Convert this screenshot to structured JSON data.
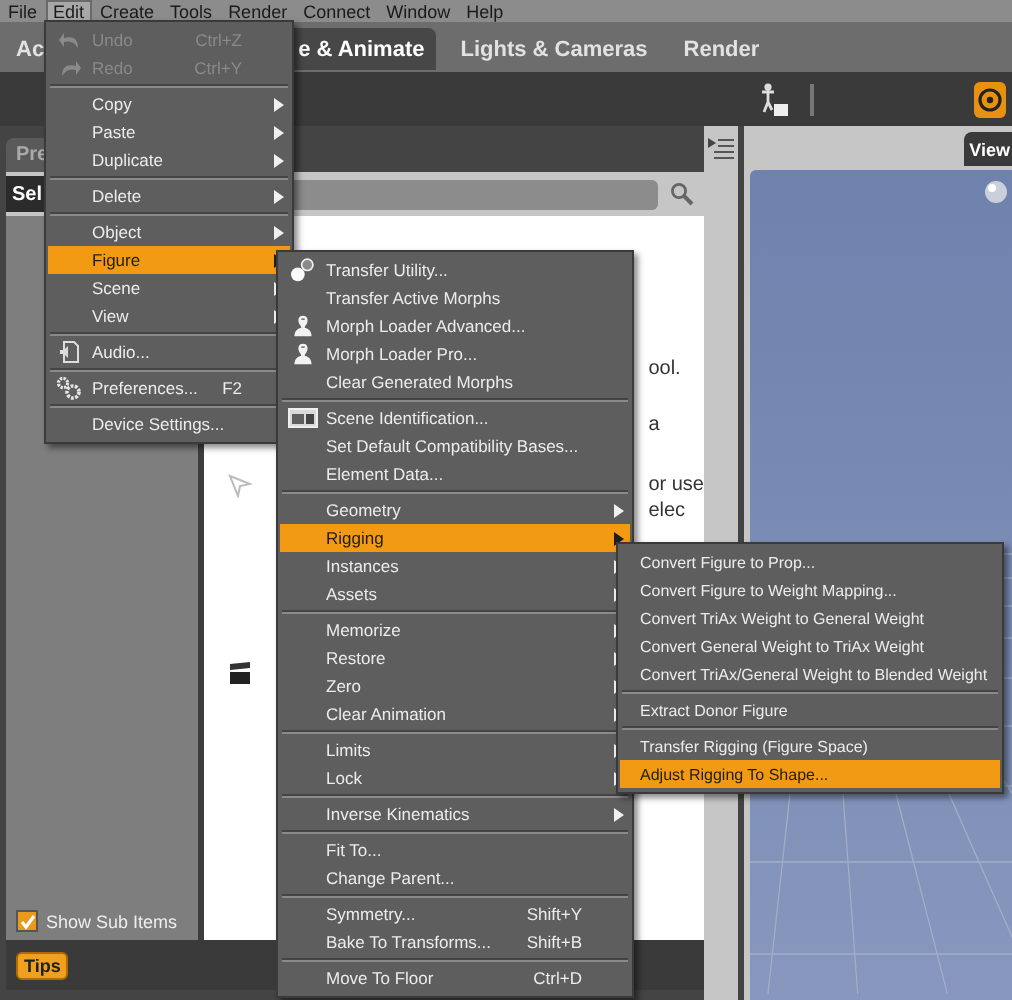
{
  "menu_bar": [
    {
      "label": "File",
      "selected": false
    },
    {
      "label": "Edit",
      "selected": true
    },
    {
      "label": "Create",
      "selected": false
    },
    {
      "label": "Tools",
      "selected": false
    },
    {
      "label": "Render",
      "selected": false
    },
    {
      "label": "Connect",
      "selected": false
    },
    {
      "label": "Window",
      "selected": false
    },
    {
      "label": "Help",
      "selected": false
    }
  ],
  "tabs": [
    {
      "label": "Ac",
      "selected": false
    },
    {
      "label": "e & Animate",
      "selected": true
    },
    {
      "label": "Lights & Cameras",
      "selected": false
    },
    {
      "label": "Render",
      "selected": false
    }
  ],
  "left_panel": {
    "tab": "Pre",
    "row_label": "Sel",
    "content_fragments": [
      "ool.",
      "a",
      "or use",
      "elec"
    ],
    "show_sub_items": {
      "label": "Show Sub Items",
      "checked": true
    },
    "tips_button": "Tips"
  },
  "viewport": {
    "tab": "View"
  },
  "menus": [
    {
      "items": [
        {
          "kind": "item",
          "label": "Undo",
          "shortcut": "Ctrl+Z",
          "submenu": false,
          "selected": false,
          "disabled": true
        },
        {
          "kind": "item",
          "label": "Redo",
          "shortcut": "Ctrl+Y",
          "submenu": false,
          "selected": false,
          "disabled": true
        },
        {
          "kind": "separator"
        },
        {
          "kind": "item",
          "label": "Copy",
          "submenu": true,
          "selected": false,
          "disabled": false
        },
        {
          "kind": "item",
          "label": "Paste",
          "submenu": true,
          "selected": false,
          "disabled": false
        },
        {
          "kind": "item",
          "label": "Duplicate",
          "submenu": true,
          "selected": false,
          "disabled": false
        },
        {
          "kind": "separator"
        },
        {
          "kind": "item",
          "label": "Delete",
          "submenu": true,
          "selected": false,
          "disabled": false
        },
        {
          "kind": "separator"
        },
        {
          "kind": "item",
          "label": "Object",
          "submenu": true,
          "selected": false,
          "disabled": false
        },
        {
          "kind": "item",
          "label": "Figure",
          "submenu": true,
          "selected": true,
          "disabled": false
        },
        {
          "kind": "item",
          "label": "Scene",
          "submenu": true,
          "selected": false,
          "disabled": false
        },
        {
          "kind": "item",
          "label": "View",
          "submenu": true,
          "selected": false,
          "disabled": false
        },
        {
          "kind": "separator"
        },
        {
          "kind": "item",
          "label": "Audio...",
          "submenu": false,
          "selected": false,
          "disabled": false
        },
        {
          "kind": "separator"
        },
        {
          "kind": "item",
          "label": "Preferences...",
          "shortcut": "F2",
          "submenu": false,
          "selected": false,
          "disabled": false
        },
        {
          "kind": "separator"
        },
        {
          "kind": "item",
          "label": "Device Settings...",
          "submenu": false,
          "selected": false,
          "disabled": false
        }
      ]
    },
    {
      "items": [
        {
          "kind": "item",
          "label": "Transfer Utility...",
          "submenu": false,
          "selected": false
        },
        {
          "kind": "item",
          "label": "Transfer Active Morphs",
          "submenu": false,
          "selected": false
        },
        {
          "kind": "item",
          "label": "Morph Loader Advanced...",
          "submenu": false,
          "selected": false
        },
        {
          "kind": "item",
          "label": "Morph Loader Pro...",
          "submenu": false,
          "selected": false
        },
        {
          "kind": "item",
          "label": "Clear Generated Morphs",
          "submenu": false,
          "selected": false
        },
        {
          "kind": "separator"
        },
        {
          "kind": "item",
          "label": "Scene Identification...",
          "submenu": false,
          "selected": false
        },
        {
          "kind": "item",
          "label": "Set Default Compatibility Bases...",
          "submenu": false,
          "selected": false
        },
        {
          "kind": "item",
          "label": "Element Data...",
          "submenu": false,
          "selected": false
        },
        {
          "kind": "separator"
        },
        {
          "kind": "item",
          "label": "Geometry",
          "submenu": true,
          "selected": false
        },
        {
          "kind": "item",
          "label": "Rigging",
          "submenu": true,
          "selected": true
        },
        {
          "kind": "item",
          "label": "Instances",
          "submenu": true,
          "selected": false
        },
        {
          "kind": "item",
          "label": "Assets",
          "submenu": true,
          "selected": false
        },
        {
          "kind": "separator"
        },
        {
          "kind": "item",
          "label": "Memorize",
          "submenu": true,
          "selected": false
        },
        {
          "kind": "item",
          "label": "Restore",
          "submenu": true,
          "selected": false
        },
        {
          "kind": "item",
          "label": "Zero",
          "submenu": true,
          "selected": false
        },
        {
          "kind": "item",
          "label": "Clear Animation",
          "submenu": true,
          "selected": false
        },
        {
          "kind": "separator"
        },
        {
          "kind": "item",
          "label": "Limits",
          "submenu": true,
          "selected": false
        },
        {
          "kind": "item",
          "label": "Lock",
          "submenu": true,
          "selected": false
        },
        {
          "kind": "separator"
        },
        {
          "kind": "item",
          "label": "Inverse Kinematics",
          "submenu": true,
          "selected": false
        },
        {
          "kind": "separator"
        },
        {
          "kind": "item",
          "label": "Fit To...",
          "submenu": false,
          "selected": false
        },
        {
          "kind": "item",
          "label": "Change Parent...",
          "submenu": false,
          "selected": false
        },
        {
          "kind": "separator"
        },
        {
          "kind": "item",
          "label": "Symmetry...",
          "shortcut": "Shift+Y",
          "submenu": false,
          "selected": false
        },
        {
          "kind": "item",
          "label": "Bake To Transforms...",
          "shortcut": "Shift+B",
          "submenu": false,
          "selected": false
        },
        {
          "kind": "separator"
        },
        {
          "kind": "item",
          "label": "Move To Floor",
          "shortcut": "Ctrl+D",
          "submenu": false,
          "selected": false
        }
      ]
    },
    {
      "items": [
        {
          "kind": "item",
          "label": "Convert Figure to Prop...",
          "submenu": false,
          "selected": false
        },
        {
          "kind": "item",
          "label": "Convert Figure to Weight Mapping...",
          "submenu": false,
          "selected": false
        },
        {
          "kind": "item",
          "label": "Convert TriAx Weight to General Weight",
          "submenu": false,
          "selected": false
        },
        {
          "kind": "item",
          "label": "Convert General Weight to TriAx Weight",
          "submenu": false,
          "selected": false
        },
        {
          "kind": "item",
          "label": "Convert TriAx/General Weight to Blended Weight",
          "submenu": false,
          "selected": false
        },
        {
          "kind": "separator"
        },
        {
          "kind": "item",
          "label": "Extract Donor Figure",
          "submenu": false,
          "selected": false
        },
        {
          "kind": "separator"
        },
        {
          "kind": "item",
          "label": "Transfer Rigging (Figure Space)",
          "submenu": false,
          "selected": false
        },
        {
          "kind": "item",
          "label": "Adjust Rigging To Shape...",
          "submenu": false,
          "selected": true
        }
      ]
    }
  ]
}
